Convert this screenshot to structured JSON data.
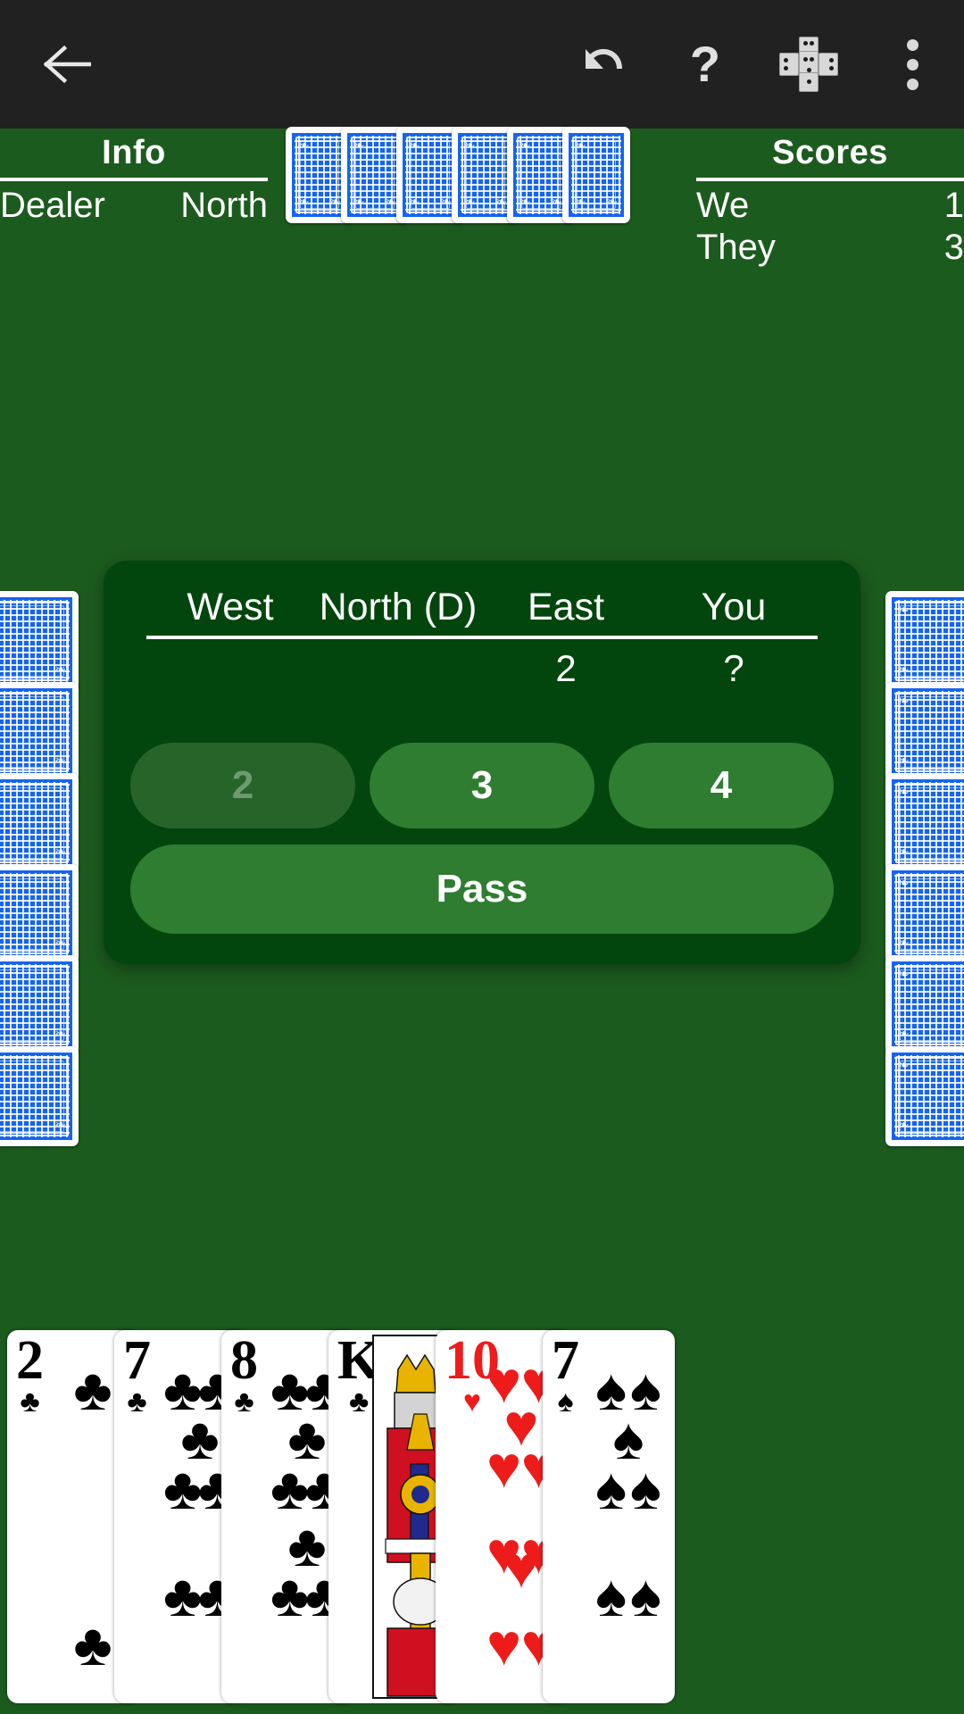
{
  "app": {
    "background_color": "#1c5b1e",
    "appbar_color": "#212121"
  },
  "appbar": {
    "back_label": "Back",
    "undo_label": "Undo",
    "help_label": "Help",
    "cards_label": "Cards",
    "more_label": "More options",
    "help_glyph": "?"
  },
  "info": {
    "title": "Info",
    "rows": [
      {
        "label": "Dealer",
        "value": "North"
      }
    ]
  },
  "scores": {
    "title": "Scores",
    "rows": [
      {
        "label": "We",
        "value": "1"
      },
      {
        "label": "They",
        "value": "3"
      }
    ]
  },
  "bidding": {
    "columns": [
      "West",
      "North (D)",
      "East",
      "You"
    ],
    "bids": [
      "",
      "",
      "2",
      "?"
    ],
    "buttons": [
      {
        "label": "2",
        "enabled": false
      },
      {
        "label": "3",
        "enabled": true
      },
      {
        "label": "4",
        "enabled": true
      }
    ],
    "pass_label": "Pass",
    "panel_color": "#03460d",
    "button_color": "#2f7d31",
    "button_disabled_color": "#27642a"
  },
  "hands": {
    "north_card_count": 6,
    "west_card_count": 6,
    "east_card_count": 6,
    "card_back_color": "#1565ef"
  },
  "player_hand": {
    "cards": [
      {
        "rank": "2",
        "suit": "♣",
        "color": "black",
        "suit_name": "clubs"
      },
      {
        "rank": "7",
        "suit": "♣",
        "color": "black",
        "suit_name": "clubs"
      },
      {
        "rank": "8",
        "suit": "♣",
        "color": "black",
        "suit_name": "clubs"
      },
      {
        "rank": "K",
        "suit": "♣",
        "color": "black",
        "suit_name": "clubs"
      },
      {
        "rank": "10",
        "suit": "♥",
        "color": "red",
        "suit_name": "hearts"
      },
      {
        "rank": "7",
        "suit": "♠",
        "color": "black",
        "suit_name": "spades"
      }
    ]
  }
}
